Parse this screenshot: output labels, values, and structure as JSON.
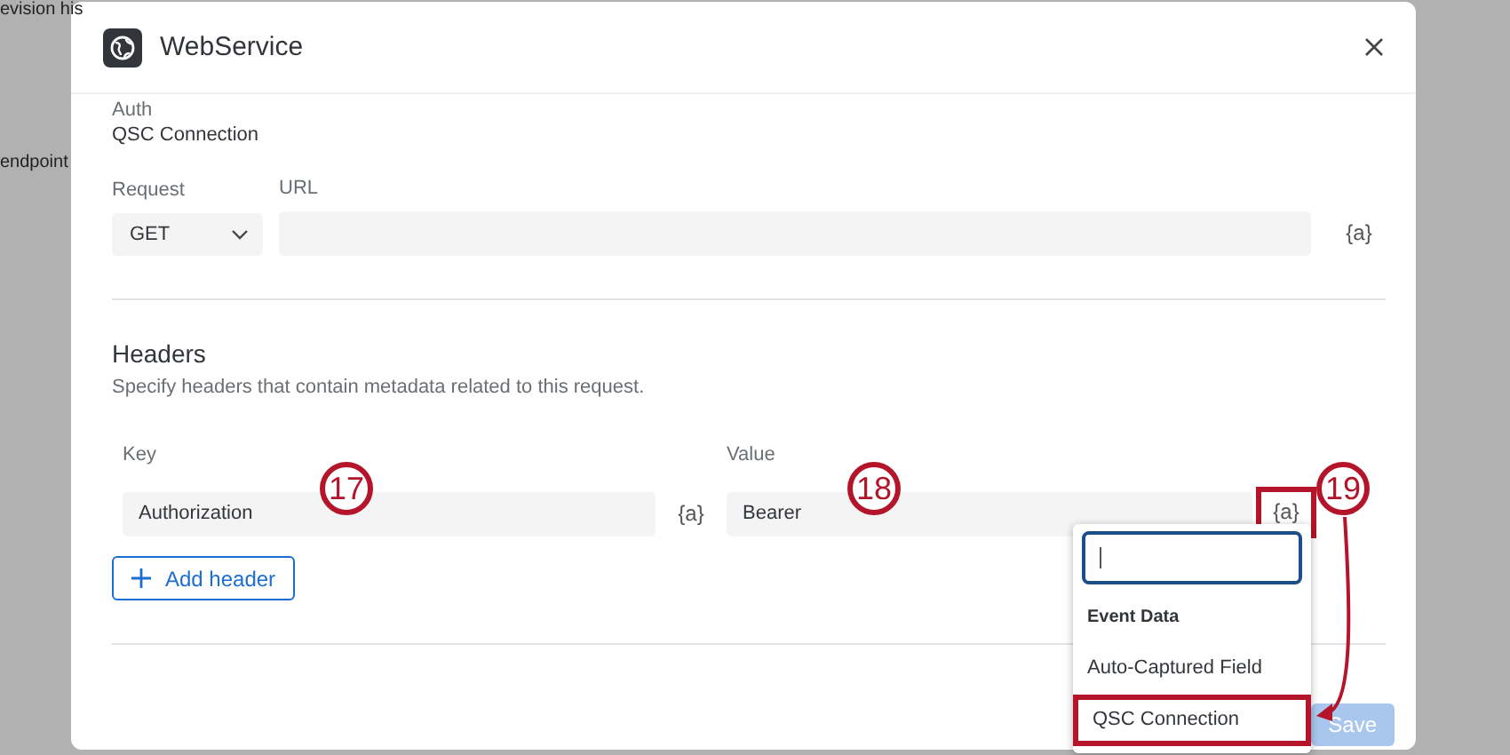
{
  "background": {
    "texts": [
      "evision his",
      "endpoint"
    ]
  },
  "dialog": {
    "title": "WebService",
    "auth": {
      "label": "Auth",
      "value": "QSC Connection"
    },
    "request": {
      "label": "Request",
      "value": "GET"
    },
    "url": {
      "label": "URL",
      "insert": "{a}"
    },
    "headers": {
      "title": "Headers",
      "description": "Specify headers that contain metadata related to this request.",
      "key_label": "Key",
      "value_label": "Value",
      "rows": [
        {
          "key": "Authorization",
          "value": "Bearer",
          "key_insert": "{a}",
          "value_insert": "{a}",
          "value_insert_highlighted": true
        }
      ],
      "add_button": "Add header"
    },
    "save_button": {
      "label": "Save",
      "disabled": true
    }
  },
  "dropdown": {
    "section": "Event Data",
    "options": [
      {
        "label": "Auto-Captured Field",
        "highlighted": false
      },
      {
        "label": "QSC Connection",
        "highlighted": true
      }
    ]
  },
  "callouts": [
    {
      "number": "17"
    },
    {
      "number": "18"
    },
    {
      "number": "19"
    }
  ]
}
